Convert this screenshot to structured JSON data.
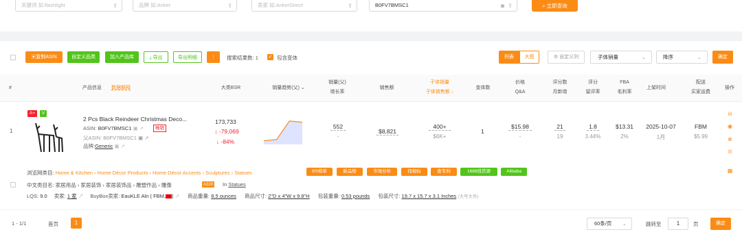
{
  "search": {
    "keyword_placeholder": "关键词 如:flashlight",
    "brand_placeholder": "品牌 如:Anker",
    "seller_placeholder": "卖家 如:AnkerDirect",
    "asin_value": "B0FV7BMSC1",
    "query_button": "立即查询"
  },
  "toolbar": {
    "copy_asin": "复制ASIN",
    "custom_category": "自定义品类",
    "add_product_lib": "加入产品库",
    "export": "导出",
    "export_detail": "导出明细",
    "more": "⋮",
    "result_count_label": "搜索结果数:",
    "result_count": "1",
    "include_variants": "包含变体",
    "view_list": "列表",
    "view_large": "大图",
    "custom_columns": "自定义列",
    "sort_field": "子体销量",
    "sort_order": "降序",
    "confirm": "确定"
  },
  "headers": {
    "index": "#",
    "product_info": "产品信息",
    "data_explain": "数据解释",
    "bsr": "大类BSR",
    "sales_trend": "销量趋势(父)",
    "sales_parent": "销量(父)",
    "growth": "增长率",
    "revenue": "销售额",
    "child_sales": "子体销量",
    "child_revenue": "子体销售额",
    "variant_count": "变体数",
    "price": "价格",
    "qa": "Q&A",
    "reviews": "评分数",
    "monthly_new": "月新增",
    "rating": "评分",
    "retention": "留评率",
    "fba": "FBA",
    "margin": "毛利率",
    "listing_date": "上架时间",
    "delivery": "配送",
    "buyer_shipping": "买家运费",
    "actions": "操作"
  },
  "row": {
    "index": "1",
    "badge_a": "A+",
    "badge_v": "V",
    "title": "2 Pcs Black Reindeer Christmas Deco...",
    "asin_label": "ASIN:",
    "asin": "B0FV7BMSC1",
    "hot_tag": "畅销",
    "parent_asin_label": "父ASIN:",
    "parent_asin": "B0FV7BMSC1",
    "brand_label": "品牌:",
    "brand": "Generic",
    "bsr": "173,733",
    "bsr_change": "↓ -79,069",
    "bsr_pct": "↓ -84%",
    "sales": "552",
    "growth": "-",
    "revenue": "$8,821",
    "child_sales": "400+",
    "child_revenue": "$6K+",
    "variants": "1",
    "price": "$15.98",
    "qa": "-",
    "reviews": "21",
    "monthly_new": "19",
    "rating": "1.8",
    "retention": "3.44%",
    "fba": "$13.31",
    "margin": "2%",
    "date": "2025-10-07",
    "age": "1月",
    "delivery": "FBM",
    "shipping": "$5.99",
    "trend": [
      0.15,
      0.2,
      0.95,
      0.9
    ]
  },
  "detail": {
    "browse_label": "浏览网类目:",
    "browse_path": "Home & Kitchen › Home Décor Products › Home Décor Accents › Sculptures › Statues",
    "tag_bs": "BS榜单",
    "tag_new": "新品榜",
    "tag_market": "市场分析",
    "tag_similar": "找相似",
    "tag_patent": "查专利",
    "tag_1688": "1688找货源",
    "tag_alibaba": "Alibaba",
    "cn_label": "中文类目名:",
    "cn_path": "家居用品 › 家居装饰 › 家居装饰品 › 雕塑作品 › 雕像",
    "rank": "#220",
    "rank_in": "In",
    "rank_cat": "Statues",
    "lqs_label": "LQS:",
    "lqs": "9.0",
    "seller_label": "卖家:",
    "seller": "1 家",
    "buybox_label": "BuyBox卖家:",
    "buybox": "EauKLE Aln ( FBM,",
    "weight_label": "商品重量:",
    "weight": "8.5 ounces",
    "dims_label": "商品尺寸:",
    "dims": "2\"D x 4\"W x 9.8\"H",
    "pkg_weight_label": "包装重量:",
    "pkg_weight": "0.53 pounds",
    "pkg_dims_label": "包装尺寸:",
    "pkg_dims": "19.7 x 15.7 x 3.1 Inches",
    "pkg_size_note": "(大号大件)"
  },
  "pagination": {
    "range": "1 - 1/1",
    "first": "首页",
    "page": "1",
    "per_page": "60条/页",
    "jump_label": "跳转至",
    "jump_value": "1",
    "page_unit": "页",
    "confirm": "确定"
  },
  "colors": {
    "accent": "#fa8c16",
    "green": "#52c41a",
    "red": "#f5222d"
  }
}
